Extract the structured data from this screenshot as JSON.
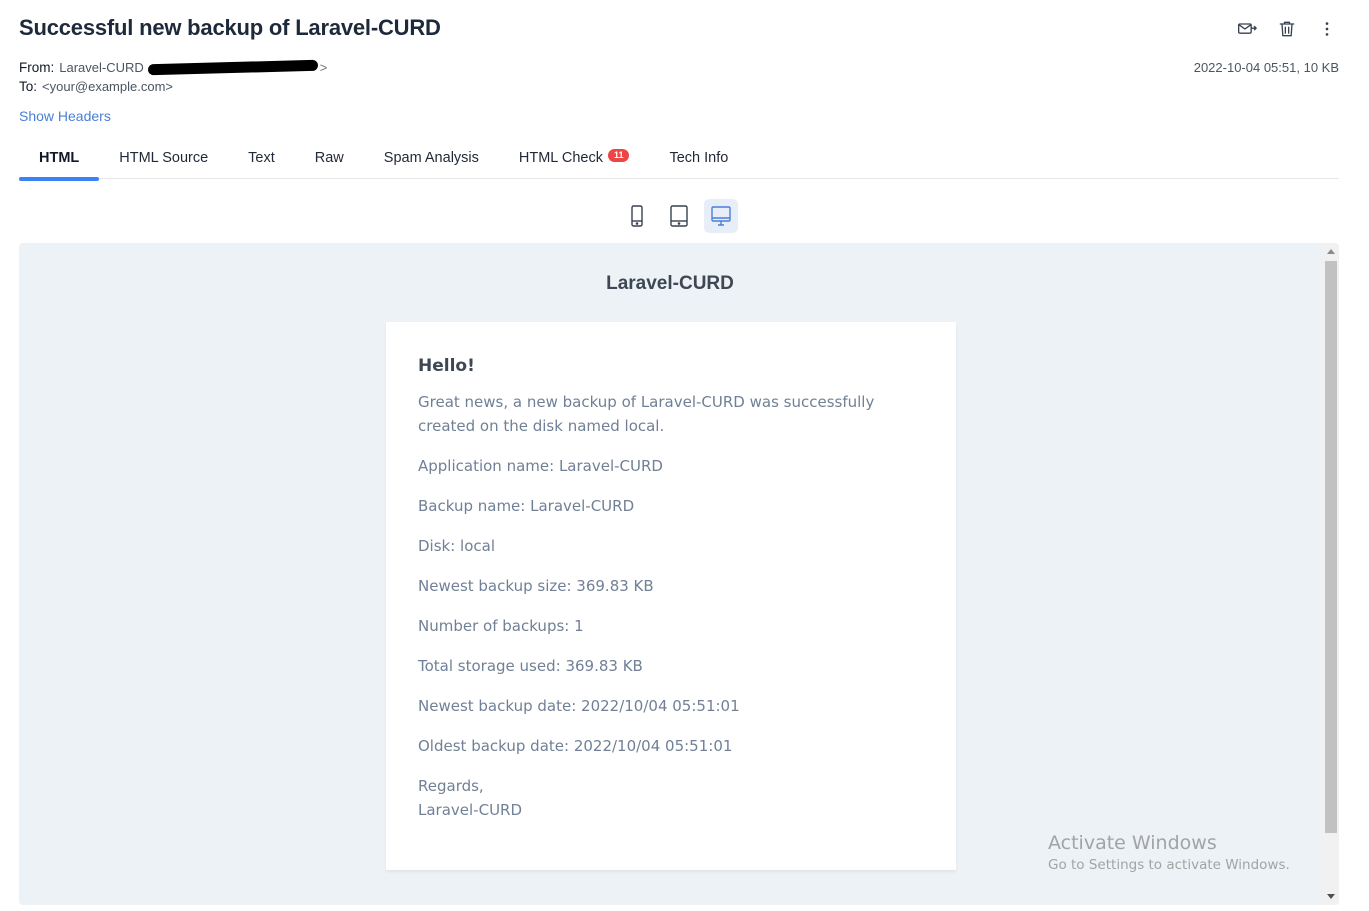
{
  "email": {
    "subject": "Successful new backup of Laravel-CURD",
    "from_label": "From:",
    "from_name": "Laravel-CURD",
    "from_tail": ">",
    "to_label": "To:",
    "to_value": "<your@example.com>",
    "date_size": "2022-10-04 05:51, 10 KB",
    "show_headers": "Show Headers"
  },
  "actions": {
    "icons": [
      "forward-mail-icon",
      "trash-icon",
      "more-vertical-icon"
    ]
  },
  "tabs": [
    {
      "label": "HTML",
      "active": true
    },
    {
      "label": "HTML Source"
    },
    {
      "label": "Text"
    },
    {
      "label": "Raw"
    },
    {
      "label": "Spam Analysis"
    },
    {
      "label": "HTML Check",
      "badge": "11"
    },
    {
      "label": "Tech Info"
    }
  ],
  "devices": {
    "icons": [
      "mobile-icon",
      "tablet-icon",
      "desktop-icon"
    ],
    "active": "desktop"
  },
  "preview": {
    "app_title": "Laravel-CURD",
    "greeting": "Hello!",
    "intro": "Great news, a new backup of Laravel-CURD was successfully created on the disk named local.",
    "lines": [
      "Application name: Laravel-CURD",
      "Backup name: Laravel-CURD",
      "Disk: local",
      "Newest backup size: 369.83 KB",
      "Number of backups: 1",
      "Total storage used: 369.83 KB",
      "Newest backup date: 2022/10/04 05:51:01",
      "Oldest backup date: 2022/10/04 05:51:01"
    ],
    "regards": "Regards,",
    "signature": "Laravel-CURD"
  },
  "watermark": {
    "line1": "Activate Windows",
    "line2": "Go to Settings to activate Windows."
  },
  "colors": {
    "accent": "#3b82f6",
    "link": "#4a7fd6",
    "badge": "#ef4444",
    "preview_bg": "#edf2f7"
  }
}
